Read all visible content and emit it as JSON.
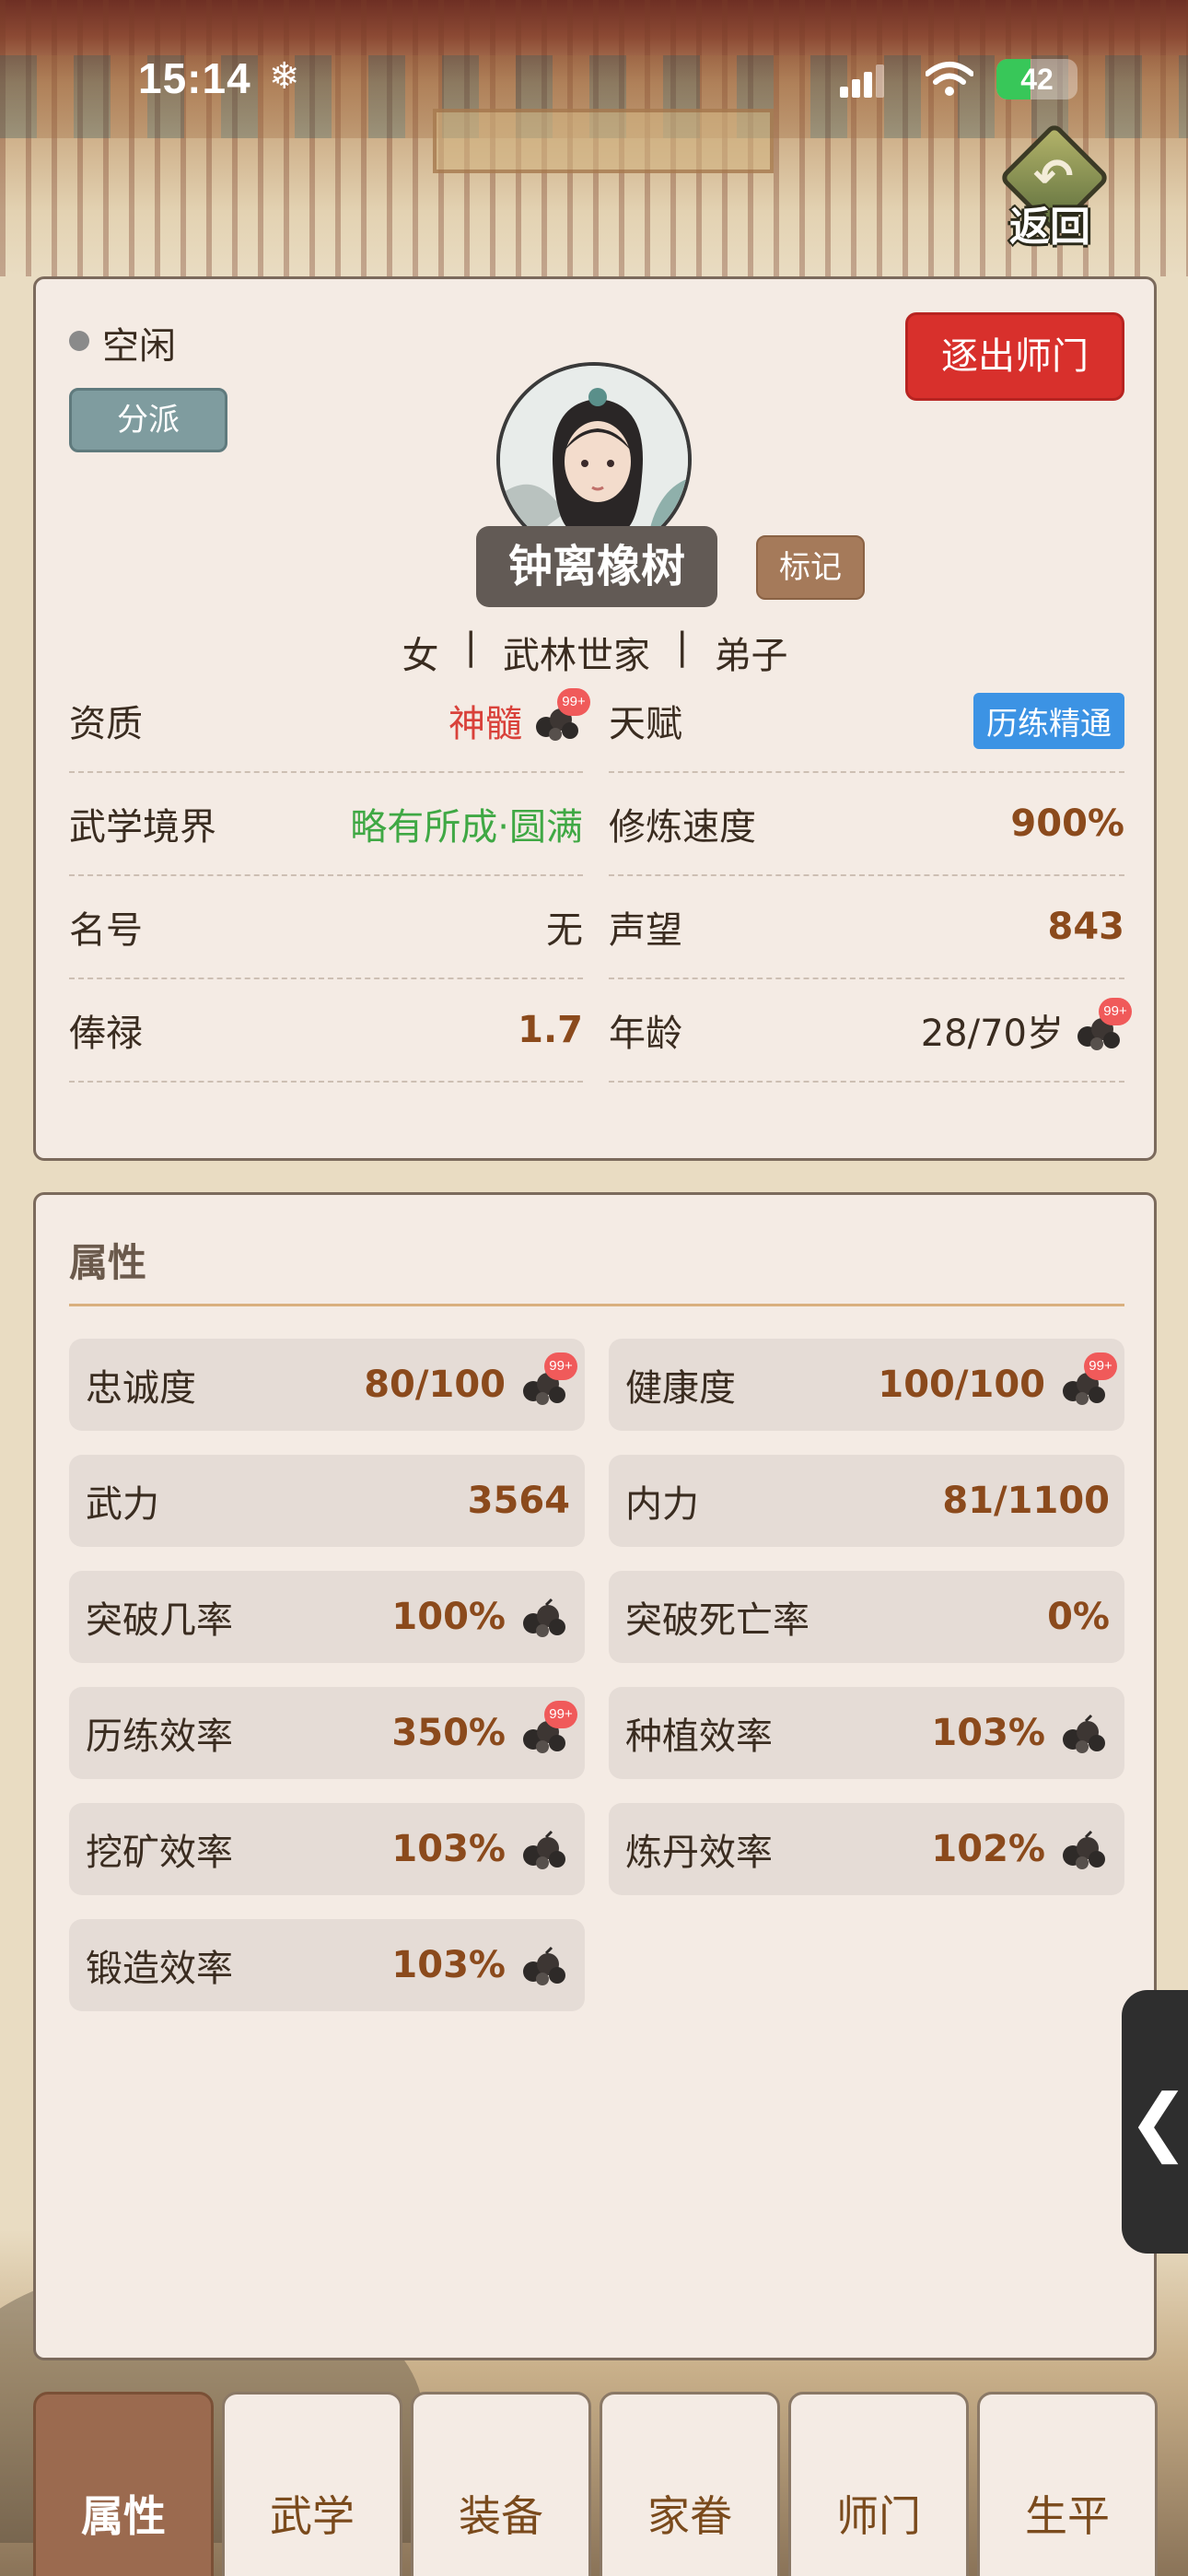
{
  "status_bar": {
    "time": "15:14",
    "weather_glyph": "❄",
    "battery": "42",
    "battery_level": 0.42,
    "icons": [
      "signal-icon",
      "wifi-icon",
      "battery-icon"
    ]
  },
  "back": {
    "label": "返回",
    "glyph": "↶"
  },
  "profile": {
    "status": "空闲",
    "branch_button": "分派",
    "expel_button": "逐出师门",
    "name": "钟离橡树",
    "mark_button": "标记",
    "gender": "女",
    "origin": "武林世家",
    "rank": "弟子",
    "separator": "|",
    "rows": [
      {
        "label": "资质",
        "value": "神髓",
        "badge": "99+"
      },
      {
        "label": "天赋",
        "value": "历练精通"
      },
      {
        "label": "武学境界",
        "value": "略有所成·圆满"
      },
      {
        "label": "修炼速度",
        "value": "900%"
      },
      {
        "label": "名号",
        "value": "无"
      },
      {
        "label": "声望",
        "value": "843"
      },
      {
        "label": "俸禄",
        "value": "1.7"
      },
      {
        "label": "年龄",
        "value": "28/70岁",
        "badge": "99+"
      }
    ]
  },
  "attributes": {
    "heading": "属性",
    "items": [
      {
        "label": "忠诚度",
        "value": "80/100",
        "badge": "99+"
      },
      {
        "label": "健康度",
        "value": "100/100",
        "badge": "99+"
      },
      {
        "label": "武力",
        "value": "3564"
      },
      {
        "label": "内力",
        "value": "81/1100"
      },
      {
        "label": "突破几率",
        "value": "100%"
      },
      {
        "label": "突破死亡率",
        "value": "0%"
      },
      {
        "label": "历练效率",
        "value": "350%",
        "badge": "99+"
      },
      {
        "label": "种植效率",
        "value": "103%"
      },
      {
        "label": "挖矿效率",
        "value": "103%"
      },
      {
        "label": "炼丹效率",
        "value": "102%"
      },
      {
        "label": "锻造效率",
        "value": "103%"
      }
    ]
  },
  "side_handle": "❮",
  "tabs": [
    "属性",
    "武学",
    "装备",
    "家眷",
    "师门",
    "生平"
  ],
  "colors": {
    "expel": "#d8302c",
    "branch": "#7f9c9f",
    "talent": "#3c93e4",
    "value_brown": "#8b4a1c",
    "value_red": "#d9413a",
    "value_green": "#3fa844",
    "active_tab": "#9b6a4f"
  }
}
